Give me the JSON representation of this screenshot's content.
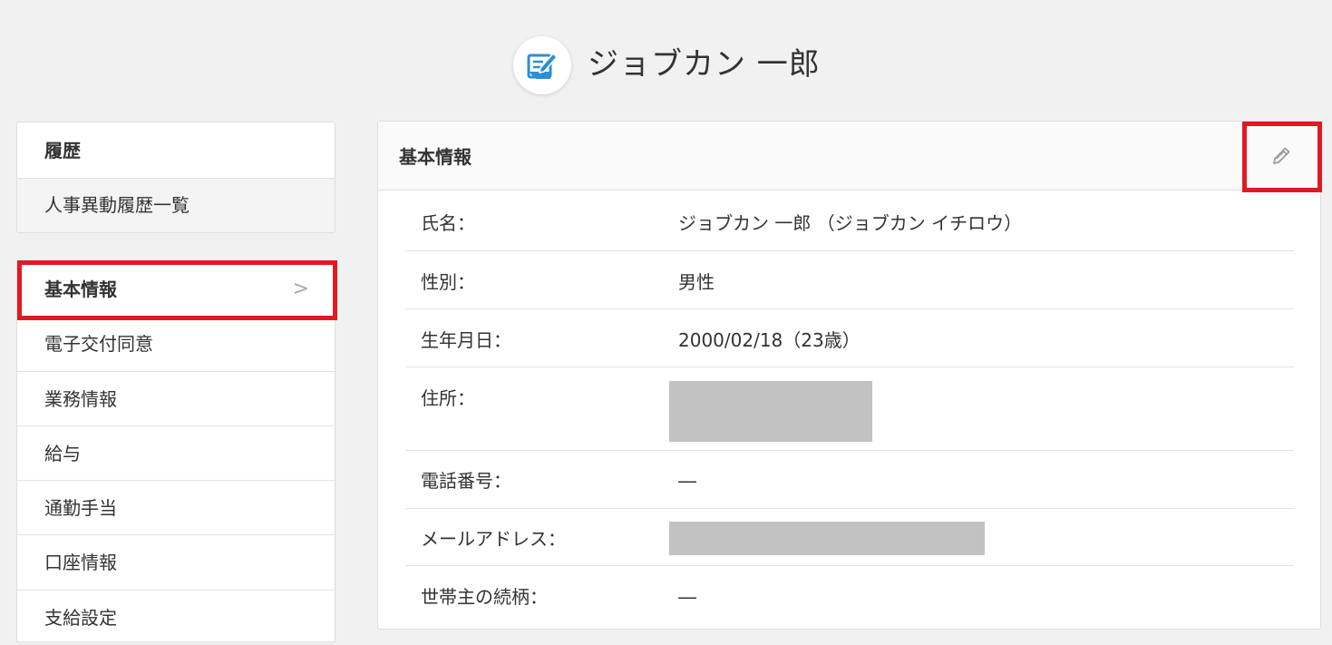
{
  "header": {
    "title": "ジョブカン 一郎",
    "avatar_icon": "edit-note-icon"
  },
  "sidebar": {
    "history": {
      "heading": "履歴",
      "link": "人事異動履歴一覧"
    },
    "menu": [
      {
        "label": "基本情報",
        "active": true
      },
      {
        "label": "電子交付同意"
      },
      {
        "label": "業務情報"
      },
      {
        "label": "給与"
      },
      {
        "label": "通勤手当"
      },
      {
        "label": "口座情報"
      },
      {
        "label": "支給設定"
      }
    ],
    "active_chevron": ">"
  },
  "panel": {
    "title": "基本情報",
    "edit_icon": "pencil-icon",
    "rows": [
      {
        "label": "氏名：",
        "value": "ジョブカン 一郎 （ジョブカン イチロウ）"
      },
      {
        "label": "性別：",
        "value": "男性"
      },
      {
        "label": "生年月日：",
        "value": "2000/02/18（23歳）"
      },
      {
        "label": "住所：",
        "value": ""
      },
      {
        "label": "電話番号：",
        "value": "―"
      },
      {
        "label": "メールアドレス：",
        "value": ""
      },
      {
        "label": "世帯主の続柄：",
        "value": "―"
      }
    ]
  },
  "colors": {
    "highlight": "#e01a22",
    "accent": "#2c8fd6",
    "redaction": "#c2c2c2"
  }
}
